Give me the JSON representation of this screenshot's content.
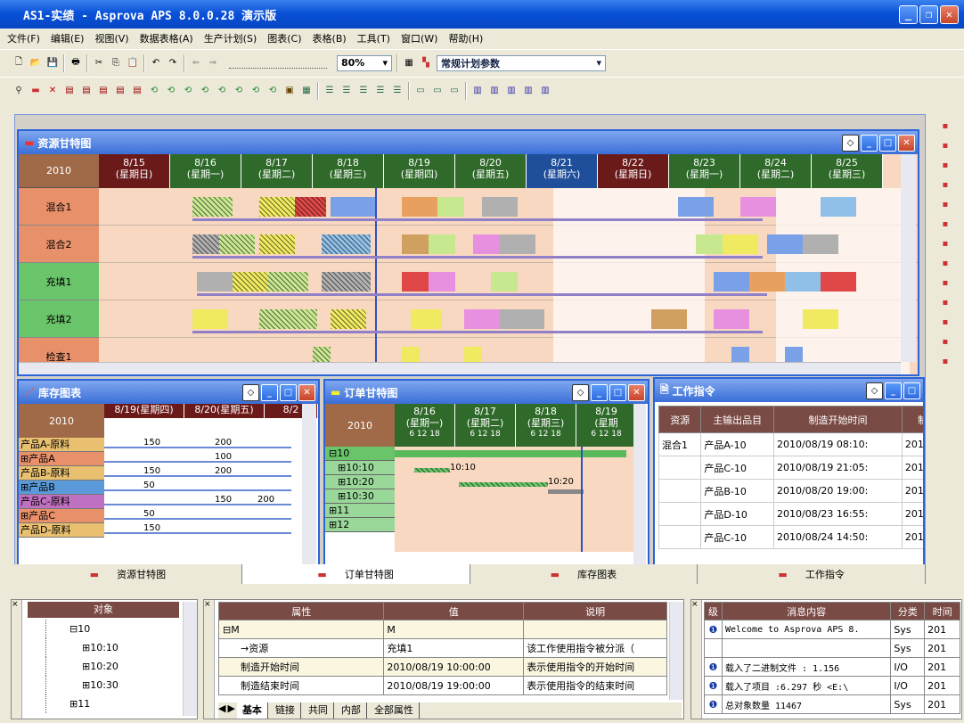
{
  "app": {
    "title": "AS1-实绩 - Asprova APS 8.0.0.28 演示版"
  },
  "menu": [
    "文件(F)",
    "编辑(E)",
    "视图(V)",
    "数据表格(A)",
    "生产计划(S)",
    "图表(C)",
    "表格(B)",
    "工具(T)",
    "窗口(W)",
    "帮助(H)"
  ],
  "toolbar": {
    "zoom": "80%",
    "param": "常规计划参数"
  },
  "resource_gantt": {
    "title": "资源甘特图",
    "year": "2010",
    "dates": [
      {
        "d": "8/15",
        "w": "(星期日)",
        "c": "#6b1a1a"
      },
      {
        "d": "8/16",
        "w": "(星期一)",
        "c": "#2f6a2a"
      },
      {
        "d": "8/17",
        "w": "(星期二)",
        "c": "#2f6a2a"
      },
      {
        "d": "8/18",
        "w": "(星期三)",
        "c": "#2f6a2a"
      },
      {
        "d": "8/19",
        "w": "(星期四)",
        "c": "#2f6a2a"
      },
      {
        "d": "8/20",
        "w": "(星期五)",
        "c": "#2f6a2a"
      },
      {
        "d": "8/21",
        "w": "(星期六)",
        "c": "#1f4f9a"
      },
      {
        "d": "8/22",
        "w": "(星期日)",
        "c": "#6b1a1a"
      },
      {
        "d": "8/23",
        "w": "(星期一)",
        "c": "#2f6a2a"
      },
      {
        "d": "8/24",
        "w": "(星期二)",
        "c": "#2f6a2a"
      },
      {
        "d": "8/25",
        "w": "(星期三)",
        "c": "#2f6a2a"
      }
    ],
    "resources": [
      {
        "n": "混合1",
        "c": "#e8906a"
      },
      {
        "n": "混合2",
        "c": "#e8906a"
      },
      {
        "n": "充填1",
        "c": "#6ac46a"
      },
      {
        "n": "充填2",
        "c": "#6ac46a"
      },
      {
        "n": "检查1",
        "c": "#e8906a"
      }
    ]
  },
  "inventory": {
    "title": "库存图表",
    "year": "2010",
    "cols": [
      "8/19(星期四)",
      "8/20(星期五)",
      "8/2"
    ],
    "rows": [
      {
        "n": "产品A-原料",
        "c": "#e8c070",
        "v1": "150",
        "v2": "200"
      },
      {
        "n": "⊞产品A",
        "c": "#e8906a",
        "v1": "",
        "v2": "100"
      },
      {
        "n": "产品B-原料",
        "c": "#e8c070",
        "v1": "150",
        "v2": "200"
      },
      {
        "n": "⊞产品B",
        "c": "#5a9ad8",
        "v1": "50",
        "v2": ""
      },
      {
        "n": "产品C-原料",
        "c": "#c070c0",
        "v1": "",
        "v2": "150",
        "v3": "200"
      },
      {
        "n": "⊞产品C",
        "c": "#e8906a",
        "v1": "50",
        "v2": ""
      },
      {
        "n": "产品D-原料",
        "c": "#e8c070",
        "v1": "150",
        "v2": ""
      }
    ]
  },
  "order_gantt": {
    "title": "订单甘特图",
    "year": "2010",
    "dates": [
      {
        "d": "8/16",
        "w": "(星期一)"
      },
      {
        "d": "8/17",
        "w": "(星期二)"
      },
      {
        "d": "8/18",
        "w": "(星期三)"
      },
      {
        "d": "8/19",
        "w": "(星期"
      }
    ],
    "ticks": "6  12  18",
    "rows": [
      "⊟10",
      "⊞10:10",
      "⊞10:20",
      "⊞10:30",
      "⊞11",
      "⊞12"
    ],
    "labels": [
      "10:10",
      "10:20"
    ]
  },
  "work_order": {
    "title": "工作指令",
    "headers": [
      "资源",
      "主输出品目",
      "制造开始时间",
      "制"
    ],
    "rows": [
      {
        "r": "混合1",
        "p": "产品A-10",
        "t": "2010/08/19 08:10:",
        "x": "2010"
      },
      {
        "r": "",
        "p": "产品C-10",
        "t": "2010/08/19 21:05:",
        "x": "2010"
      },
      {
        "r": "",
        "p": "产品B-10",
        "t": "2010/08/20 19:00:",
        "x": "2010"
      },
      {
        "r": "",
        "p": "产品D-10",
        "t": "2010/08/23 16:55:",
        "x": "2010"
      },
      {
        "r": "",
        "p": "产品C-10",
        "t": "2010/08/24 14:50:",
        "x": "2010"
      }
    ]
  },
  "tabs": [
    "资源甘特图",
    "订单甘特图",
    "库存图表",
    "工作指令"
  ],
  "object_panel": {
    "header": "对象",
    "items": [
      "⊟10",
      "⊞10:10",
      "⊞10:20",
      "⊞10:30",
      "⊞11"
    ]
  },
  "property_panel": {
    "headers": [
      "属性",
      "值",
      "说明"
    ],
    "rows": [
      {
        "a": "⊟M",
        "v": "M",
        "d": ""
      },
      {
        "a": "→资源",
        "v": "充填1",
        "d": "该工作使用指令被分派（"
      },
      {
        "a": "制造开始时间",
        "v": "2010/08/19 10:00:00",
        "d": "表示使用指令的开始时间"
      },
      {
        "a": "制造结束时间",
        "v": "2010/08/19 19:00:00",
        "d": "表示使用指令的结束时间"
      }
    ],
    "tabs": [
      "基本",
      "链接",
      "共同",
      "内部",
      "全部属性"
    ]
  },
  "message_panel": {
    "headers": [
      "级",
      "消息内容",
      "分类",
      "时间"
    ],
    "rows": [
      {
        "m": "Welcome to Asprova APS 8.",
        "c": "Sys",
        "t": "201"
      },
      {
        "m": "",
        "c": "Sys",
        "t": "201"
      },
      {
        "m": "载入了二进制文件 :  1.156",
        "c": "I/O",
        "t": "201"
      },
      {
        "m": "载入了项目 :6.297 秒 <E:\\",
        "c": "I/O",
        "t": "201"
      },
      {
        "m": "总对象数量 11467",
        "c": "Sys",
        "t": "201"
      }
    ]
  }
}
